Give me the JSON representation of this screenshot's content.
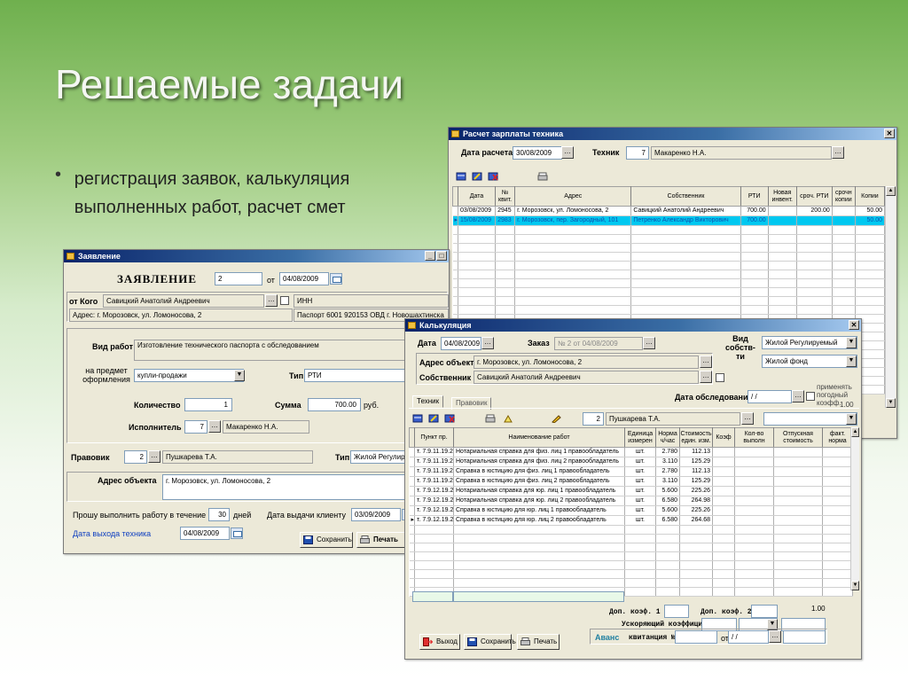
{
  "slide": {
    "title": "Решаемые задачи",
    "bullet": "регистрация заявок, калькуляция выполненных работ, расчет смет"
  },
  "salary": {
    "title": "Расчет зарплаты техника",
    "date_label": "Дата расчета",
    "date_value": "30/08/2009",
    "tech_label": "Техник",
    "tech_num": "7",
    "tech_name": "Макаренко Н.А.",
    "headers": [
      "Дата",
      "№ квит.",
      "Адрес",
      "Собственник",
      "РТИ",
      "Новая инвент.",
      "сроч. РТИ",
      "срочн копии",
      "Копии"
    ],
    "rows": [
      [
        "03/08/2009",
        "2945",
        "г. Морозовск, ул. Ломоносова, 2",
        "Савицкий Анатолий Андреевич",
        "700.00",
        "",
        "200.00",
        "",
        "50.00"
      ],
      [
        "15/08/2009",
        "2983",
        "г. Морозовск, пер. Загородный, 101",
        "Петренко Александр Викторович",
        "700.00",
        "",
        "",
        "",
        "50.00"
      ]
    ]
  },
  "request": {
    "title": "Заявление",
    "heading": "ЗАЯВЛЕНИЕ",
    "num": "2",
    "from_label": "от",
    "date": "04/08/2009",
    "from_whom_label": "от Кого",
    "from_whom": "Савицкий Анатолий Андреевич",
    "inn": "ИНН",
    "address": "Адрес: г. Морозовск, ул. Ломоносова, 2",
    "passport": "Паспорт 6001 920153 ОВД г. Новошахтинска",
    "work_type_label": "Вид работ",
    "work_type": "Изготовление технического паспорта с обследованием",
    "subject_label": "на предмет оформления",
    "subject": "купли-продажи",
    "type_label": "Тип",
    "type_value": "РТИ",
    "qty_label": "Количество",
    "qty": "1",
    "sum_label": "Сумма",
    "sum": "700.00",
    "currency": "руб.",
    "executor_label": "Исполнитель",
    "executor_num": "7",
    "executor": "Макаренко Н.А.",
    "lawyer_label": "Правовик",
    "lawyer_num": "2",
    "lawyer": "Пушкарева Т.А.",
    "type2_label": "Тип",
    "type2": "Жилой Регулир",
    "object_label": "Адрес объекта",
    "object": "г. Морозовск, ул. Ломоносова, 2",
    "term_label": "Прошу выполнить работу в течение",
    "term": "30",
    "term_unit": "дней",
    "issue_label": "Дата выдачи клиенту",
    "issue_date": "03/09/2009",
    "tech_out_label": "Дата выхода техника",
    "tech_out_date": "04/08/2009",
    "save": "Сохранить",
    "print": "Печать"
  },
  "calc": {
    "title": "Калькуляция",
    "date_label": "Дата",
    "date": "04/08/2009",
    "order_label": "Заказ",
    "order": "№ 2 от 04/08/2009",
    "kind_label": "Вид собств-ти",
    "kind": "Жилой Регулируемый",
    "fund": "Жилой фонд",
    "object_label": "Адрес объекта",
    "object": "г. Морозовск, ул. Ломоносова, 2",
    "owner_label": "Собственник",
    "owner": "Савицкий Анатолий Андреевич",
    "survey_label": "Дата обследования",
    "survey": "/ /",
    "coef_label": "применять погодный коэфф.",
    "coef_value": "1.00",
    "tab1": "Техник",
    "tab2": "Правовик",
    "exec_num": "2",
    "exec_name": "Пушкарева Т.А.",
    "headers": [
      "Пункт пр.",
      "Наименование работ",
      "Единица измерен",
      "Норма ч/час",
      "Стоимость един. изм.",
      "Коэф",
      "Кол-во выполн",
      "Отпускная стоимость",
      "факт. норма"
    ],
    "rows": [
      [
        "т. 7.9.11.19.2",
        "Нотариальная справка для физ. лиц 1 правообладатель",
        "шт.",
        "2.780",
        "112.13"
      ],
      [
        "т. 7.9.11.19.2",
        "Нотариальная справка для физ. лиц 2 правообладатель",
        "шт.",
        "3.110",
        "125.29"
      ],
      [
        "т. 7.9.11.19.2",
        "Справка в юстицию для физ. лиц 1 правообладатель",
        "шт.",
        "2.780",
        "112.13"
      ],
      [
        "т. 7.9.11.19.2",
        "Справка в юстицию для физ. лиц 2 правообладатель",
        "шт.",
        "3.110",
        "125.29"
      ],
      [
        "т. 7.9.12.19.2",
        "Нотариальная справка для юр. лиц 1 правообладатель",
        "шт.",
        "5.600",
        "225.26"
      ],
      [
        "т. 7.9.12.19.2",
        "Нотариальная справка для юр. лиц 2 правообладатель",
        "шт.",
        "6.580",
        "264.98"
      ],
      [
        "т. 7.9.12.19.2",
        "Справка в юстицию для юр. лиц 1 правообладатель",
        "шт.",
        "5.600",
        "225.26"
      ],
      [
        "т. 7.9.12.19.2",
        "Справка в юстицию для юр. лиц 2 правообладатель",
        "шт.",
        "6.580",
        "264.68"
      ]
    ],
    "add_coef1": "Доп. коэф. 1",
    "add_coef2": "Доп. коэф. 2",
    "total": "1.00",
    "accel_label": "Ускоряющий коэффициент",
    "advance_label": "Аванс",
    "receipt_label": "квитанция №",
    "from": "от",
    "date_empty": "/ /",
    "exit": "Выход",
    "save": "Сохранить",
    "print": "Печать"
  }
}
